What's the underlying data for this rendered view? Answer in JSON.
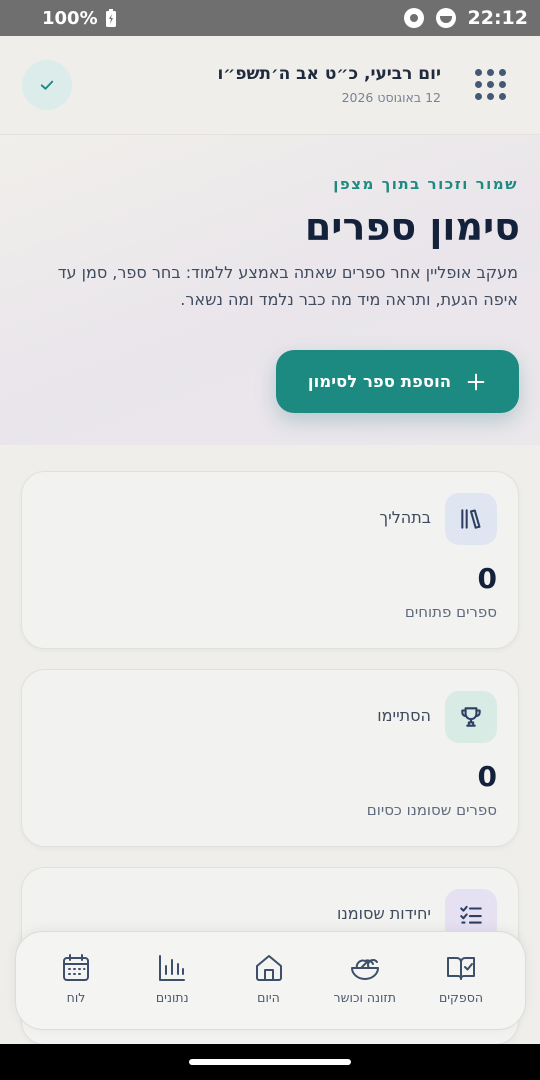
{
  "status_bar": {
    "battery": "100%",
    "time": "22:12"
  },
  "header": {
    "hebrew_date": "יום רביעי, כ״ט אב ה׳תשפ״ו",
    "gregorian_date": "12 באוגוסט 2026"
  },
  "hero": {
    "eyebrow": "שמור וזכור בתוך מצפן",
    "title": "סימון ספרים",
    "description": "מעקב אופליין אחר ספרים שאתה באמצע ללמוד: בחר ספר, סמן עד איפה הגעת, ותראה מיד מה כבר נלמד ומה נשאר.",
    "add_button": "הוספת ספר לסימון"
  },
  "cards": [
    {
      "label": "בתהליך",
      "value": "0",
      "sub": "ספרים פתוחים",
      "icon": "books-icon",
      "color": "#dfe6f2"
    },
    {
      "label": "הסתיימו",
      "value": "0",
      "sub": "ספרים שסומנו כסיום",
      "icon": "trophy-icon",
      "color": "#d8ebe5"
    },
    {
      "label": "יחידות שסומנו",
      "value": "",
      "sub": "",
      "icon": "checklist-icon",
      "color": "#e6e1f2"
    }
  ],
  "bottom_nav": [
    {
      "label": "הספקים",
      "icon": "book-check-icon"
    },
    {
      "label": "תזונה וכושר",
      "icon": "salad-icon"
    },
    {
      "label": "היום",
      "icon": "home-icon"
    },
    {
      "label": "נתונים",
      "icon": "bar-chart-icon"
    },
    {
      "label": "לוח",
      "icon": "calendar-icon"
    }
  ],
  "colors": {
    "accent": "#1c8a80",
    "title": "#13213a",
    "text": "#3f4b5f"
  }
}
